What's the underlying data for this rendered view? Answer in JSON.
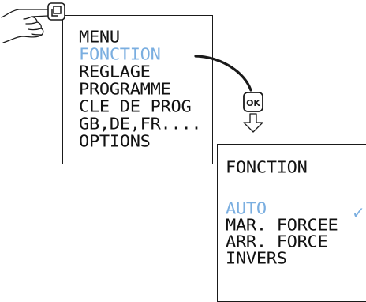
{
  "menu_screen": {
    "title": "MENU",
    "items": [
      {
        "label": "FONCTION",
        "selected": true
      },
      {
        "label": "REGLAGE",
        "selected": false
      },
      {
        "label": "PROGRAMME",
        "selected": false
      },
      {
        "label": "CLE DE PROG",
        "selected": false
      },
      {
        "label": "GB,DE,FR....",
        "selected": false
      },
      {
        "label": "OPTIONS",
        "selected": false
      }
    ]
  },
  "ok_button": {
    "label": "OK"
  },
  "fonction_screen": {
    "title": "FONCTION",
    "items": [
      {
        "label": "AUTO",
        "selected": true,
        "checked": true
      },
      {
        "label": "MAR. FORCEE",
        "selected": false
      },
      {
        "label": "ARR. FORCE",
        "selected": false
      },
      {
        "label": "INVERS",
        "selected": false
      }
    ],
    "check_mark": "✓"
  },
  "icons": [
    "pressing-hand-icon",
    "menu-key-icon",
    "curved-arrow-icon",
    "ok-key-icon",
    "down-arrow-icon"
  ],
  "colors": {
    "selected": "#7aaee0",
    "text": "#111111",
    "border": "#1a1a1a"
  }
}
